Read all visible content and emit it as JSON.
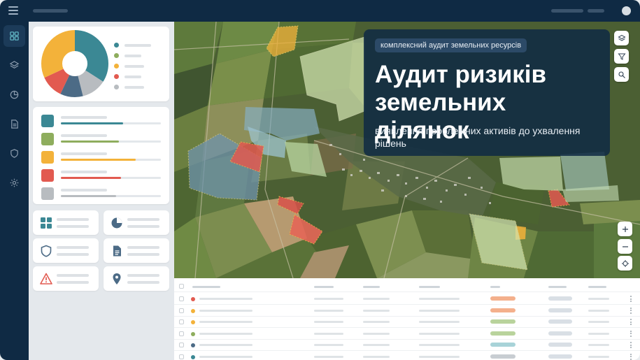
{
  "hero": {
    "chip": "комплексний аудит земельних ресурсів",
    "title": "Аудит ризиків земельних ділянок",
    "subtitle": "виявлення проблемних активів до ухвалення рішень"
  },
  "colors": {
    "nav": "#0f2a44",
    "teal": "#3b8894",
    "green": "#8ead5d",
    "yellow": "#f3b23a",
    "red": "#e25a50",
    "slate": "#4c6b86",
    "gray": "#b8bcc0"
  },
  "rail": {
    "items": [
      {
        "icon": "grid-icon",
        "active": true
      },
      {
        "icon": "layers-icon",
        "active": false
      },
      {
        "icon": "pie-chart-icon",
        "active": false
      },
      {
        "icon": "document-icon",
        "active": false
      },
      {
        "icon": "shield-icon",
        "active": false
      },
      {
        "icon": "settings-icon",
        "active": false
      }
    ]
  },
  "donut_widget": {
    "segments": [
      {
        "color": "#3b8894",
        "share": 0.34
      },
      {
        "color": "#b8bcc0",
        "share": 0.12
      },
      {
        "color": "#4c6b86",
        "share": 0.11
      },
      {
        "color": "#e25a50",
        "share": 0.11
      },
      {
        "color": "#f3b23a",
        "share": 0.32
      }
    ],
    "legend_colors": [
      "#3b8894",
      "#8ead5d",
      "#f3b23a",
      "#e25a50",
      "#b8bcc0"
    ]
  },
  "bars_widget": {
    "items": [
      {
        "color": "#3b8894",
        "fill": 0.62
      },
      {
        "color": "#8ead5d",
        "fill": 0.58
      },
      {
        "color": "#f3b23a",
        "fill": 0.75
      },
      {
        "color": "#e25a50",
        "fill": 0.6
      },
      {
        "color": "#b8bcc0",
        "fill": 0.55
      }
    ]
  },
  "tiles": [
    {
      "icon": "grid-icon"
    },
    {
      "icon": "pie-chart-icon"
    },
    {
      "icon": "shield-icon"
    },
    {
      "icon": "document-icon"
    },
    {
      "icon": "warning-icon"
    },
    {
      "icon": "location-pin-icon"
    }
  ],
  "map_controls": {
    "top": [
      "layers-icon",
      "filter-icon",
      "search-icon"
    ],
    "bottom": [
      "zoom-in-icon",
      "zoom-out-icon",
      "locate-icon"
    ]
  },
  "table": {
    "rows": [
      {
        "dot": "#e25a50",
        "status": "#f4b08c"
      },
      {
        "dot": "#f3b23a",
        "status": "#f4b08c"
      },
      {
        "dot": "#f3b23a",
        "status": "#b9d39c"
      },
      {
        "dot": "#8ead5d",
        "status": "#b9d39c"
      },
      {
        "dot": "#4c6b86",
        "status": "#a8d3d8"
      },
      {
        "dot": "#3b8894",
        "status": "#c8cdd2"
      }
    ]
  }
}
